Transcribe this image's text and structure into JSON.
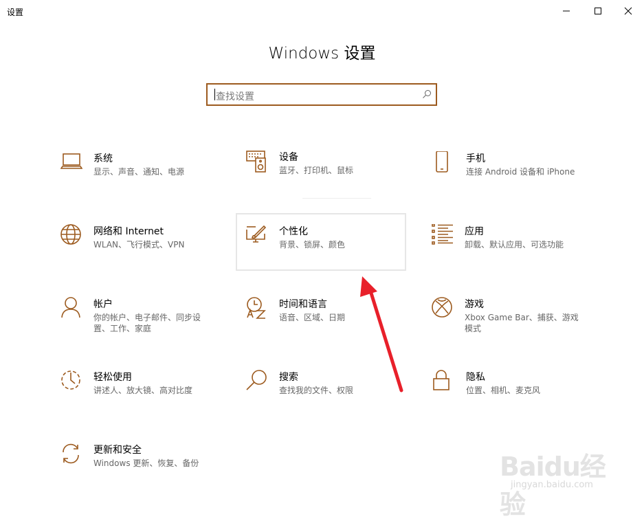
{
  "window": {
    "title": "设置",
    "controls": [
      "minimize-icon",
      "maximize-icon",
      "close-icon"
    ]
  },
  "heading": "Windows 设置",
  "search": {
    "placeholder": "查找设置",
    "icon": "search-icon"
  },
  "tiles": [
    {
      "icon": "laptop-icon",
      "name": "系统",
      "desc": "显示、声音、通知、电源"
    },
    {
      "icon": "keyboard-speaker-icon",
      "name": "设备",
      "desc": "蓝牙、打印机、鼠标"
    },
    {
      "icon": "phone-icon",
      "name": "手机",
      "desc": "连接 Android 设备和 iPhone"
    },
    {
      "icon": "globe-icon",
      "name": "网络和 Internet",
      "desc": "WLAN、飞行模式、VPN"
    },
    {
      "icon": "paint-monitor-icon",
      "name": "个性化",
      "desc": "背景、锁屏、颜色"
    },
    {
      "icon": "app-list-icon",
      "name": "应用",
      "desc": "卸载、默认应用、可选功能"
    },
    {
      "icon": "person-icon",
      "name": "帐户",
      "desc": "你的帐户、电子邮件、同步设置、工作、家庭"
    },
    {
      "icon": "clock-language-icon",
      "name": "时间和语言",
      "desc": "语音、区域、日期"
    },
    {
      "icon": "xbox-icon",
      "name": "游戏",
      "desc": "Xbox Game Bar、捕获、游戏模式"
    },
    {
      "icon": "accessibility-timer-icon",
      "name": "轻松使用",
      "desc": "讲述人、放大镜、高对比度"
    },
    {
      "icon": "magnifier-icon",
      "name": "搜索",
      "desc": "查找我的文件、权限"
    },
    {
      "icon": "lock-icon",
      "name": "隐私",
      "desc": "位置、相机、麦克风"
    },
    {
      "icon": "sync-icon",
      "name": "更新和安全",
      "desc": "Windows 更新、恢复、备份"
    }
  ],
  "colors": {
    "accent": "#9c5a1e",
    "annotation_arrow": "#e8202a",
    "text_secondary": "#666666"
  },
  "watermark": {
    "logo": "Baidu经验",
    "url": "jingyan.baidu.com"
  }
}
